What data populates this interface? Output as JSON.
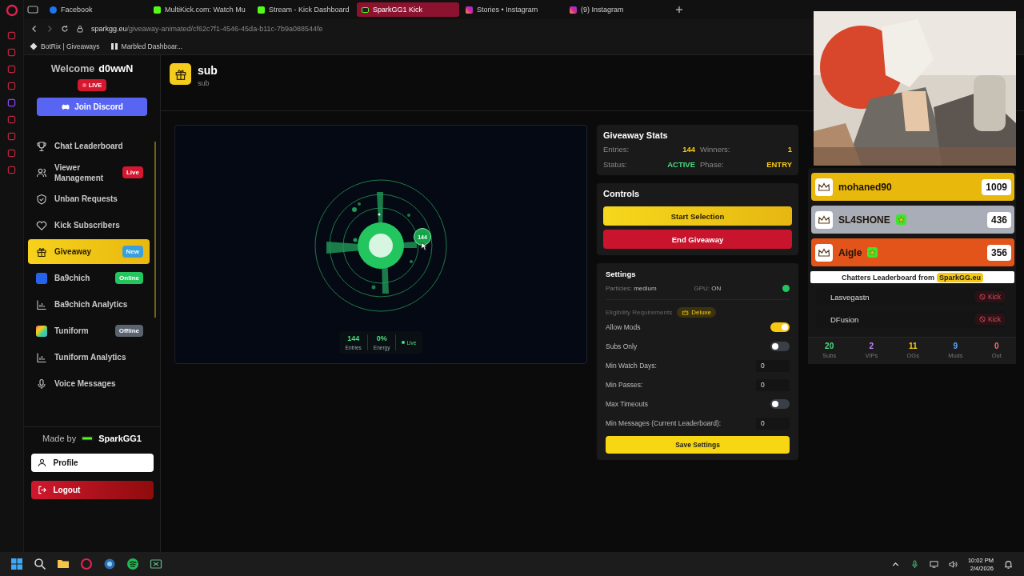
{
  "browser": {
    "tabs": [
      {
        "label": "Facebook",
        "selected": false
      },
      {
        "label": "MultiKick.com: Watch Mu",
        "selected": false
      },
      {
        "label": "Stream - Kick Dashboard",
        "selected": false
      },
      {
        "label": "SparkGG1 Kick",
        "selected": true
      },
      {
        "label": "Stories • Instagram",
        "selected": false
      },
      {
        "label": "(9) Instagram",
        "selected": false
      }
    ],
    "address": {
      "domain": "sparkgg.eu",
      "path": "/giveaway-animated/cf62c7f1-4546-45da-b11c-7b9a088544fe"
    },
    "bookmarks": [
      {
        "label": "BotRix | Giveaways"
      },
      {
        "label": "Marbled Dashboar..."
      }
    ]
  },
  "sidebar": {
    "welcome": "Welcome",
    "username": "d0wwN",
    "live_badge": "LIVE",
    "discord_button": "Join Discord",
    "nav": [
      {
        "label": "Chat Leaderboard",
        "selected": false
      },
      {
        "label": "Viewer Management",
        "selected": false,
        "badge": {
          "label": "Live",
          "kind": "live"
        }
      },
      {
        "label": "Unban Requests",
        "selected": false
      },
      {
        "label": "Kick Subscribers",
        "selected": false
      },
      {
        "label": "Giveaway",
        "selected": true,
        "badge": {
          "label": "New",
          "kind": "new"
        }
      },
      {
        "label": "Ba9chich",
        "selected": false,
        "badge": {
          "label": "Online",
          "kind": "online"
        }
      },
      {
        "label": "Ba9chich Analytics",
        "selected": false
      },
      {
        "label": "Tuniform",
        "selected": false,
        "badge": {
          "label": "Offline",
          "kind": "offline"
        }
      },
      {
        "label": "Tuniform Analytics",
        "selected": false
      },
      {
        "label": "Voice Messages",
        "selected": false
      }
    ],
    "made_by": "Made by",
    "made_by_name": "SparkGG1",
    "profile": "Profile",
    "logout": "Logout"
  },
  "header": {
    "title": "sub",
    "subtitle": "sub"
  },
  "visualizer": {
    "bubble": "144",
    "stats": [
      {
        "value": "144",
        "label": "Entries"
      },
      {
        "value": "0%",
        "label": "Energy"
      }
    ],
    "live_label": "Live"
  },
  "stats_card": {
    "title": "Giveaway Stats",
    "rows": [
      {
        "label": "Entries:",
        "value": "144",
        "color": "#facc15"
      },
      {
        "label": "Winners:",
        "value": "1",
        "color": "#facc15"
      },
      {
        "label": "Status:",
        "value": "ACTIVE",
        "color": "#4ade80"
      },
      {
        "label": "Phase:",
        "value": "ENTRY",
        "color": "#facc15"
      }
    ]
  },
  "controls": {
    "title": "Controls",
    "buttons": [
      {
        "label": "Start Selection",
        "kind": "primary"
      },
      {
        "label": "End Giveaway",
        "kind": "danger"
      }
    ]
  },
  "settings": {
    "title": "Settings",
    "particles_label": "Particles:",
    "particles_value": "medium",
    "gpu_label": "GPU:",
    "gpu_value": "ON",
    "gpu_ok": true,
    "eligibility": "Eligibility Requirements",
    "tier_badge": "Deluxe",
    "options": [
      {
        "kind": "toggle",
        "label": "Allow Mods",
        "on": true
      },
      {
        "kind": "toggle",
        "label": "Subs Only",
        "on": false
      },
      {
        "kind": "number",
        "label": "Min Watch Days:",
        "value": "0"
      },
      {
        "kind": "number",
        "label": "Min Passes:",
        "value": "0"
      },
      {
        "kind": "toggle",
        "label": "Max Timeouts",
        "on": false
      },
      {
        "kind": "number",
        "label": "Min Messages (Current Leaderboard):",
        "value": "0"
      }
    ],
    "save": "Save Settings"
  },
  "overlay": {
    "leaders": [
      {
        "name": "mohaned90",
        "score": "1009",
        "color": "#e8b80c",
        "star": false
      },
      {
        "name": "SL4SHONE",
        "score": "436",
        "color": "#a9adb8",
        "star": true
      },
      {
        "name": "Aigle",
        "score": "356",
        "color": "#e2541a",
        "star": true
      }
    ],
    "banner": "Chatters Leaderboard from",
    "brand": "SparkGG.eu",
    "chatters": [
      {
        "name": "Lasvegastn",
        "action": "Kick"
      },
      {
        "name": "DFusion",
        "action": "Kick"
      }
    ],
    "counts": [
      {
        "value": "20",
        "label": "Subs",
        "color": "#4ade80"
      },
      {
        "value": "2",
        "label": "VIPs",
        "color": "#c084fc"
      },
      {
        "value": "11",
        "label": "OGs",
        "color": "#facc15"
      },
      {
        "value": "9",
        "label": "Mods",
        "color": "#60a5fa"
      },
      {
        "value": "0",
        "label": "Out",
        "color": "#f87171"
      }
    ]
  },
  "taskbar": {
    "time": "10:02 PM",
    "date": "2/4/2026"
  }
}
